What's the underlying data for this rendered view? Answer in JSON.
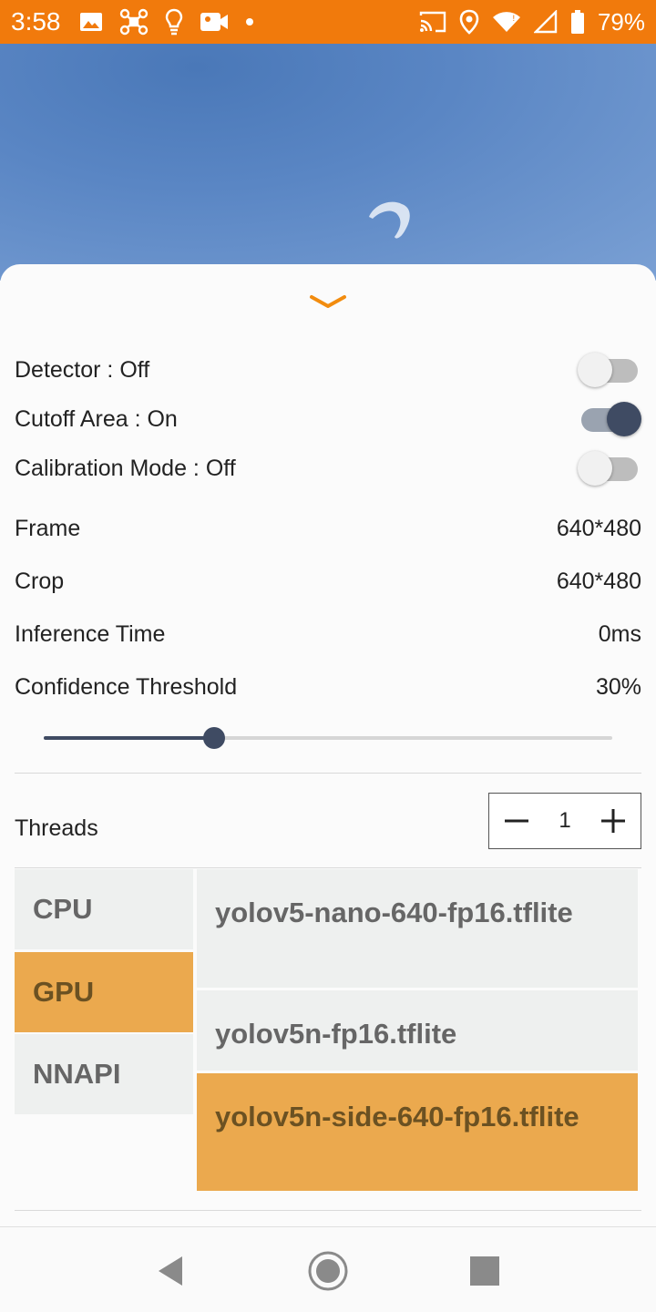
{
  "status_bar": {
    "time": "3:58",
    "battery": "79%",
    "icons_left": [
      "image-icon",
      "drone-icon",
      "lightbulb-icon",
      "video-camera-icon",
      "dot-icon"
    ],
    "icons_right": [
      "cast-icon",
      "location-icon",
      "wifi-icon",
      "signal-icon",
      "battery-icon"
    ]
  },
  "sheet": {
    "toggles": [
      {
        "label": "Detector : Off",
        "on": false
      },
      {
        "label": "Cutoff Area : On",
        "on": true
      },
      {
        "label": "Calibration Mode : Off",
        "on": false
      }
    ],
    "info": [
      {
        "label": "Frame",
        "value": "640*480"
      },
      {
        "label": "Crop",
        "value": "640*480"
      },
      {
        "label": "Inference Time",
        "value": "0ms"
      },
      {
        "label": "Confidence Threshold",
        "value": "30%"
      }
    ],
    "confidence_fraction": 0.3,
    "threads_label": "Threads",
    "threads_value": "1",
    "delegates": [
      {
        "label": "CPU",
        "selected": false
      },
      {
        "label": "GPU",
        "selected": true
      },
      {
        "label": "NNAPI",
        "selected": false
      }
    ],
    "models": [
      {
        "label": "yolov5-nano-640-fp16.tflite",
        "selected": false
      },
      {
        "label": "yolov5n-fp16.tflite",
        "selected": false
      },
      {
        "label": "yolov5n-side-640-fp16.tflite",
        "selected": true
      }
    ]
  },
  "colors": {
    "status_bar": "#f17a0c",
    "accent": "#eba94e",
    "control": "#3f4b63"
  }
}
